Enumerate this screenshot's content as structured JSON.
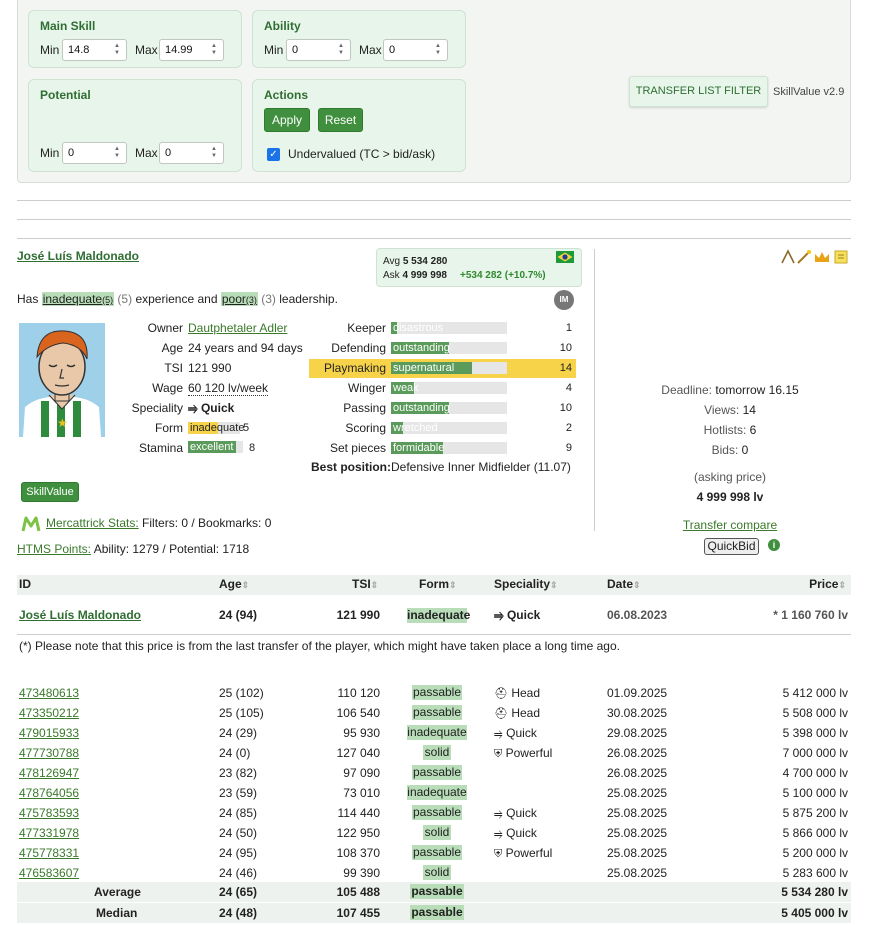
{
  "filter": {
    "main_skill": {
      "title": "Main Skill",
      "min_label": "Min",
      "min": "14.8",
      "max_label": "Max",
      "max": "14.99"
    },
    "ability": {
      "title": "Ability",
      "min_label": "Min",
      "min": "0",
      "max_label": "Max",
      "max": "0"
    },
    "potential": {
      "title": "Potential",
      "min_label": "Min",
      "min": "0",
      "max_label": "Max",
      "max": "0"
    },
    "actions": {
      "title": "Actions",
      "apply": "Apply",
      "reset": "Reset",
      "undervalued_label": "Undervalued (TC > bid/ask)",
      "undervalued_checked": true
    },
    "transfer_list_filter": "TRANSFER LIST FILTER",
    "version": "SkillValue v2.9"
  },
  "player": {
    "name": "José Luís Maldonado",
    "avg_label": "Avg",
    "avg_value": "5 534 280",
    "ask_label": "Ask",
    "ask_value": "4 999 998",
    "ask_diff": "+534 282 (+10.7%)",
    "experience_prefix": "Has",
    "experience_level": "inadequate",
    "experience_level_num": "(5)",
    "experience_num": "(5)",
    "experience_text": "experience and",
    "leadership_level": "poor",
    "leadership_level_num": "(3)",
    "leadership_num": "(3)",
    "leadership_text": "leadership.",
    "im_badge": "IM",
    "info": [
      {
        "label": "Owner",
        "value": "Dautphetaler Adler"
      },
      {
        "label": "Age",
        "value": "24 years and 94 days"
      },
      {
        "label": "TSI",
        "value": "121 990"
      },
      {
        "label": "Wage",
        "value": "60 120 lv/week"
      },
      {
        "label": "Speciality",
        "value": "Quick"
      },
      {
        "label": "Form",
        "value": "inadequate",
        "num": "5"
      },
      {
        "label": "Stamina",
        "value": "excellent",
        "num": "8"
      }
    ],
    "skills": [
      {
        "label": "Keeper",
        "value": "disastrous",
        "num": "1",
        "level": 1
      },
      {
        "label": "Defending",
        "value": "outstanding",
        "num": "10",
        "level": 10
      },
      {
        "label": "Playmaking",
        "value": "supernatural",
        "num": "14",
        "level": 14
      },
      {
        "label": "Winger",
        "value": "weak",
        "num": "4",
        "level": 4
      },
      {
        "label": "Passing",
        "value": "outstanding",
        "num": "10",
        "level": 10
      },
      {
        "label": "Scoring",
        "value": "wretched",
        "num": "2",
        "level": 2
      },
      {
        "label": "Set pieces",
        "value": "formidable",
        "num": "9",
        "level": 9
      }
    ],
    "best_position_label": "Best position:",
    "best_position": "Defensive Inner Midfielder (11.07)",
    "skillvalue_button": "SkillValue",
    "mercattrick_label": "Mercattrick Stats:",
    "mercattrick_text": "Filters: 0 / Bookmarks: 0",
    "htms_label": "HTMS Points:",
    "htms_text": "Ability: 1279 / Potential: 1718"
  },
  "side": {
    "deadline_label": "Deadline:",
    "deadline": "tomorrow 16.15",
    "views_label": "Views:",
    "views": "14",
    "hotlists_label": "Hotlists:",
    "hotlists": "6",
    "bids_label": "Bids:",
    "bids": "0",
    "asking_label": "(asking price)",
    "asking_value": "4 999 998 lv",
    "transfer_compare": "Transfer compare",
    "quickbid": "QuickBid",
    "info_icon": "i"
  },
  "table": {
    "headers": {
      "id": "ID",
      "age": "Age",
      "tsi": "TSI",
      "form": "Form",
      "speciality": "Speciality",
      "date": "Date",
      "price": "Price"
    },
    "player_row": {
      "id": "José Luís Maldonado",
      "age": "24 (94)",
      "tsi": "121 990",
      "form": "inadequate",
      "speciality": "Quick",
      "date": "06.08.2023",
      "price": "* 1 160 760 lv"
    },
    "note": "(*) Please note that this price is from the last transfer of the player, which might have taken place a long time ago.",
    "rows": [
      {
        "id": "473480613",
        "age": "25 (102)",
        "tsi": "110 120",
        "form": "passable",
        "speciality": "Head",
        "date": "01.09.2025",
        "price": "5 412 000 lv"
      },
      {
        "id": "473350212",
        "age": "25 (105)",
        "tsi": "106 540",
        "form": "passable",
        "speciality": "Head",
        "date": "30.08.2025",
        "price": "5 508 000 lv"
      },
      {
        "id": "479015933",
        "age": "24 (29)",
        "tsi": "95 930",
        "form": "inadequate",
        "speciality": "Quick",
        "date": "29.08.2025",
        "price": "5 398 000 lv"
      },
      {
        "id": "477730788",
        "age": "24 (0)",
        "tsi": "127 040",
        "form": "solid",
        "speciality": "Powerful",
        "date": "26.08.2025",
        "price": "7 000 000 lv"
      },
      {
        "id": "478126947",
        "age": "23 (82)",
        "tsi": "97 090",
        "form": "passable",
        "speciality": "",
        "date": "26.08.2025",
        "price": "4 700 000 lv"
      },
      {
        "id": "478764056",
        "age": "23 (59)",
        "tsi": "73 010",
        "form": "inadequate",
        "speciality": "",
        "date": "25.08.2025",
        "price": "5 100 000 lv"
      },
      {
        "id": "475783593",
        "age": "24 (85)",
        "tsi": "114 440",
        "form": "passable",
        "speciality": "Quick",
        "date": "25.08.2025",
        "price": "5 875 200 lv"
      },
      {
        "id": "477331978",
        "age": "24 (50)",
        "tsi": "122 950",
        "form": "solid",
        "speciality": "Quick",
        "date": "25.08.2025",
        "price": "5 866 000 lv"
      },
      {
        "id": "475778331",
        "age": "24 (95)",
        "tsi": "108 370",
        "form": "passable",
        "speciality": "Powerful",
        "date": "25.08.2025",
        "price": "5 200 000 lv"
      },
      {
        "id": "476583607",
        "age": "24 (46)",
        "tsi": "99 390",
        "form": "solid",
        "speciality": "",
        "date": "25.08.2025",
        "price": "5 283 600 lv"
      }
    ],
    "average": {
      "label": "Average",
      "age": "24 (65)",
      "tsi": "105 488",
      "form": "passable",
      "price": "5 534 280 lv"
    },
    "median": {
      "label": "Median",
      "age": "24 (48)",
      "tsi": "107 455",
      "form": "passable",
      "price": "5 405 000 lv"
    }
  },
  "colors": {
    "accent": "#3f8f3f",
    "highlight": "#f7d34a",
    "light_green": "#e8f5ea"
  }
}
